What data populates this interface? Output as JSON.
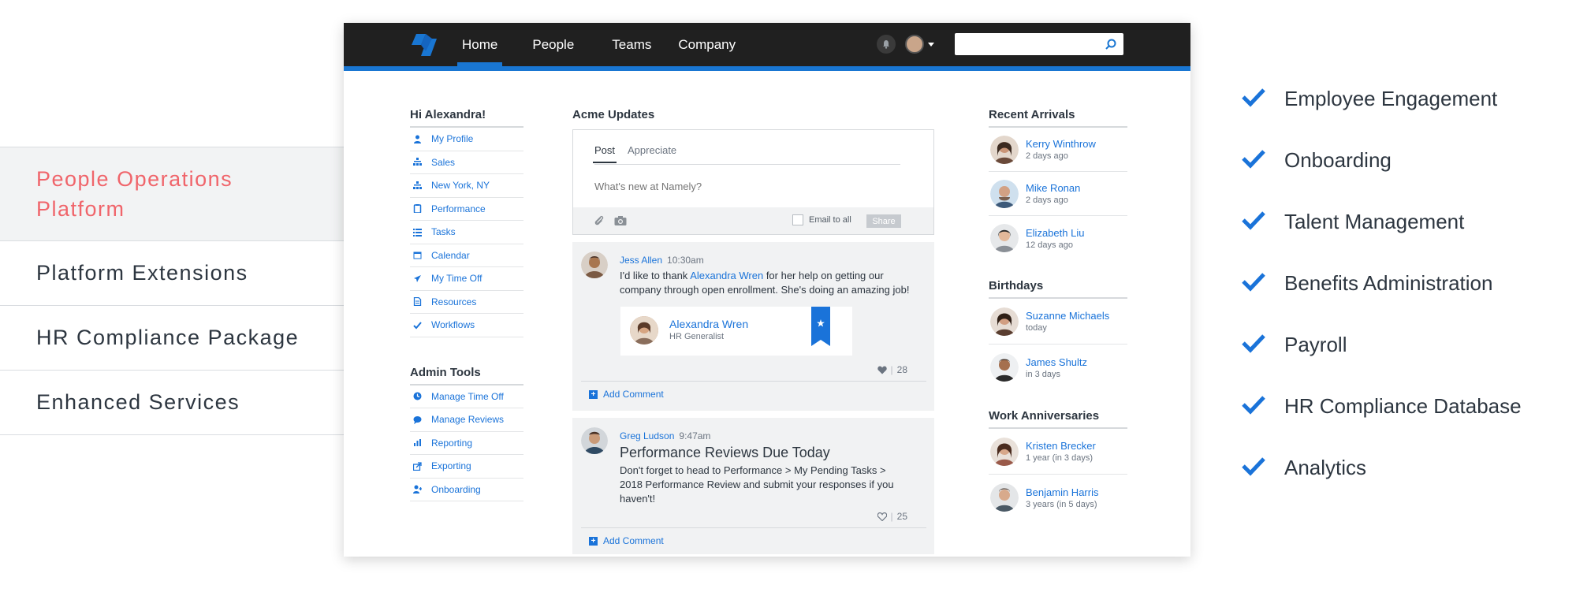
{
  "left_menu": {
    "items": [
      {
        "label": "People Operations Platform",
        "active": true
      },
      {
        "label": "Platform Extensions"
      },
      {
        "label": "HR Compliance Package"
      },
      {
        "label": "Enhanced Services"
      }
    ]
  },
  "features": {
    "items": [
      "Employee Engagement",
      "Onboarding",
      "Talent Management",
      "Benefits Administration",
      "Payroll",
      "HR Compliance Database",
      "Analytics"
    ],
    "check_color": "#1a73d9"
  },
  "app": {
    "brand_color": "#1976d2",
    "nav": {
      "items": [
        "Home",
        "People",
        "Teams",
        "Company"
      ],
      "active": "Home"
    },
    "search": {
      "value": ""
    },
    "sidebar": {
      "greeting": "Hi Alexandra!",
      "items": [
        {
          "label": "My Profile",
          "icon": "user-icon"
        },
        {
          "label": "Sales",
          "icon": "org-chart-icon"
        },
        {
          "label": "New York, NY",
          "icon": "org-chart-icon"
        },
        {
          "label": "Performance",
          "icon": "clipboard-icon"
        },
        {
          "label": "Tasks",
          "icon": "list-icon"
        },
        {
          "label": "Calendar",
          "icon": "calendar-icon"
        },
        {
          "label": "My Time Off",
          "icon": "plane-icon"
        },
        {
          "label": "Resources",
          "icon": "document-icon"
        },
        {
          "label": "Workflows",
          "icon": "check-icon"
        }
      ],
      "admin_title": "Admin Tools",
      "admin_items": [
        {
          "label": "Manage Time Off",
          "icon": "clock-icon"
        },
        {
          "label": "Manage Reviews",
          "icon": "chat-icon"
        },
        {
          "label": "Reporting",
          "icon": "bar-chart-icon"
        },
        {
          "label": "Exporting",
          "icon": "export-icon"
        },
        {
          "label": "Onboarding",
          "icon": "add-user-icon"
        }
      ]
    },
    "feed": {
      "title": "Acme Updates",
      "composer": {
        "tabs": [
          "Post",
          "Appreciate"
        ],
        "active_tab": "Post",
        "placeholder": "What's new at Namely?",
        "email_all_label": "Email to all",
        "share_label": "Share"
      },
      "posts": [
        {
          "author": "Jess Allen",
          "time": "10:30am",
          "body_pre": "I'd like to thank ",
          "body_link": "Alexandra Wren",
          "body_post": " for her help on getting our company through open enrollment. She's doing an amazing job!",
          "kudos": {
            "name": "Alexandra Wren",
            "role": "HR Generalist"
          },
          "likes": "28",
          "add_comment": "Add Comment"
        },
        {
          "author": "Greg Ludson",
          "time": "9:47am",
          "title": "Performance Reviews Due Today",
          "body": "Don't forget to head to Performance > My Pending Tasks > 2018 Performance Review and submit your responses if you haven't!",
          "likes": "25",
          "add_comment": "Add Comment"
        }
      ]
    },
    "right": {
      "recent_title": "Recent Arrivals",
      "recent": [
        {
          "name": "Kerry Winthrow",
          "sub": "2 days ago"
        },
        {
          "name": "Mike Ronan",
          "sub": "2 days ago"
        },
        {
          "name": "Elizabeth Liu",
          "sub": "12 days ago"
        }
      ],
      "birthdays_title": "Birthdays",
      "birthdays": [
        {
          "name": "Suzanne Michaels",
          "sub": "today"
        },
        {
          "name": "James Shultz",
          "sub": "in 3 days"
        }
      ],
      "anniv_title": "Work Anniversaries",
      "anniv": [
        {
          "name": "Kristen Brecker",
          "sub": "1 year (in 3 days)"
        },
        {
          "name": "Benjamin Harris",
          "sub": "3 years (in 5 days)"
        }
      ]
    }
  }
}
